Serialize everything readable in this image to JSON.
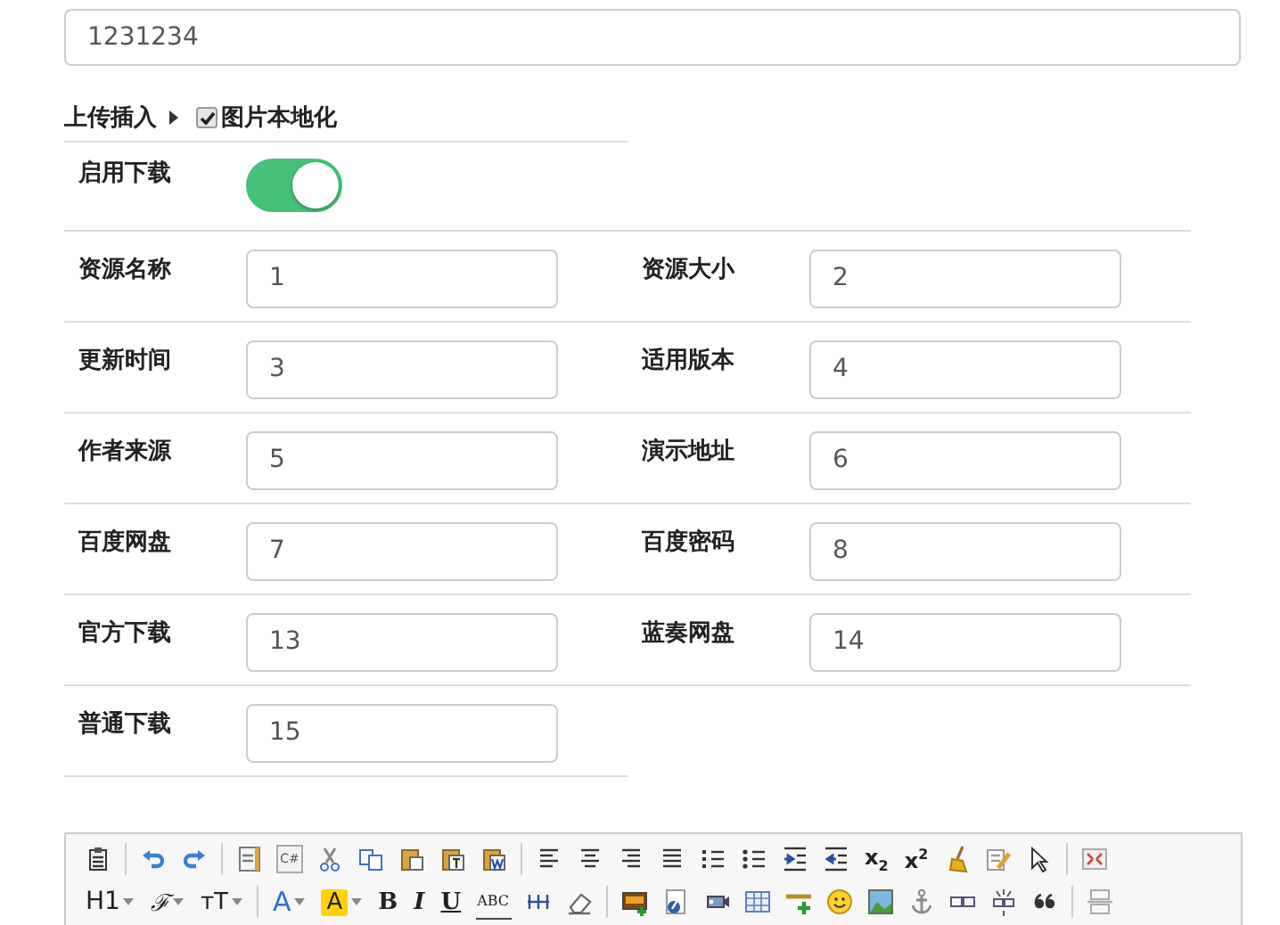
{
  "title_field": {
    "value": "1231234"
  },
  "upload": {
    "label": "上传插入",
    "localize": {
      "label": "图片本地化",
      "checked": true
    }
  },
  "download_toggle": {
    "label": "启用下载",
    "on": true
  },
  "fields": [
    {
      "label": "资源名称",
      "value": "1"
    },
    {
      "label": "资源大小",
      "value": "2"
    },
    {
      "label": "更新时间",
      "value": "3"
    },
    {
      "label": "适用版本",
      "value": "4"
    },
    {
      "label": "作者来源",
      "value": "5"
    },
    {
      "label": "演示地址",
      "value": "6"
    },
    {
      "label": "百度网盘",
      "value": "7"
    },
    {
      "label": "百度密码",
      "value": "8"
    },
    {
      "label": "官方下载",
      "value": "13"
    },
    {
      "label": "蓝奏网盘",
      "value": "14"
    },
    {
      "label": "普通下载",
      "value": "15"
    }
  ],
  "editor": {
    "toolbar_rows": [
      [
        {
          "kind": "clipboard"
        },
        {
          "kind": "separator"
        },
        {
          "kind": "undo"
        },
        {
          "kind": "redo"
        },
        {
          "kind": "separator"
        },
        {
          "kind": "document"
        },
        {
          "kind": "code-file",
          "label": "C#"
        },
        {
          "kind": "scissors"
        },
        {
          "kind": "copy"
        },
        {
          "kind": "paste"
        },
        {
          "kind": "paste-text"
        },
        {
          "kind": "paste-word"
        },
        {
          "kind": "separator"
        },
        {
          "kind": "align-left"
        },
        {
          "kind": "align-center"
        },
        {
          "kind": "align-right"
        },
        {
          "kind": "align-justify"
        },
        {
          "kind": "numbered-list"
        },
        {
          "kind": "bullet-list"
        },
        {
          "kind": "indent"
        },
        {
          "kind": "outdent"
        },
        {
          "kind": "subscript",
          "label": "x$_{2}$"
        },
        {
          "kind": "superscript",
          "label": "x$^{2}$"
        },
        {
          "kind": "broom"
        },
        {
          "kind": "pencil-document"
        },
        {
          "kind": "cursor"
        },
        {
          "kind": "separator"
        },
        {
          "kind": "fullscreen"
        }
      ],
      [
        {
          "kind": "heading",
          "label": "H1",
          "dropdown": true
        },
        {
          "kind": "font-family",
          "label": "ℱ",
          "dropdown": true
        },
        {
          "kind": "font-size",
          "label": "тT",
          "dropdown": true
        },
        {
          "kind": "separator"
        },
        {
          "kind": "font-color",
          "label": "A",
          "dropdown": true
        },
        {
          "kind": "highlight",
          "label": "A",
          "dropdown": true
        },
        {
          "kind": "bold",
          "label": "B"
        },
        {
          "kind": "italic",
          "label": "I"
        },
        {
          "kind": "underline",
          "label": "U"
        },
        {
          "kind": "strikethrough",
          "label": "ABC"
        },
        {
          "kind": "dotted-lines"
        },
        {
          "kind": "eraser"
        },
        {
          "kind": "separator"
        },
        {
          "kind": "image-add"
        },
        {
          "kind": "flash-document"
        },
        {
          "kind": "video-camera"
        },
        {
          "kind": "table"
        },
        {
          "kind": "line-add"
        },
        {
          "kind": "smiley"
        },
        {
          "kind": "picture"
        },
        {
          "kind": "anchor"
        },
        {
          "kind": "link"
        },
        {
          "kind": "unlink"
        },
        {
          "kind": "quote"
        },
        {
          "kind": "separator"
        },
        {
          "kind": "page-break"
        }
      ]
    ]
  }
}
